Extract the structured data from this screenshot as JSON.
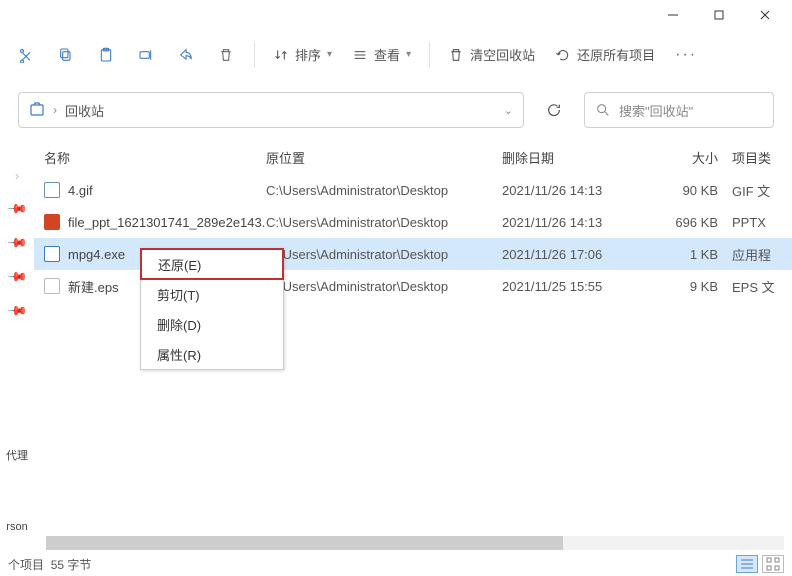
{
  "titlebar": {},
  "toolbar": {
    "sort_label": "排序",
    "view_label": "查看",
    "empty_label": "清空回收站",
    "restore_all_label": "还原所有项目"
  },
  "addressbar": {
    "location": "回收站",
    "search_placeholder": "搜索\"回收站\""
  },
  "columns": {
    "name": "名称",
    "path": "原位置",
    "date": "删除日期",
    "size": "大小",
    "type": "项目类"
  },
  "files": [
    {
      "name": "4.gif",
      "path": "C:\\Users\\Administrator\\Desktop",
      "date": "2021/11/26 14:13",
      "size": "90 KB",
      "type": "GIF 文",
      "kind": "gif"
    },
    {
      "name": "file_ppt_1621301741_289e2e143...",
      "path": "C:\\Users\\Administrator\\Desktop",
      "date": "2021/11/26 14:13",
      "size": "696 KB",
      "type": "PPTX",
      "kind": "ppt"
    },
    {
      "name": "mpg4.exe",
      "path": "C:\\Users\\Administrator\\Desktop",
      "date": "2021/11/26 17:06",
      "size": "1 KB",
      "type": "应用程",
      "kind": "exe",
      "selected": true
    },
    {
      "name": "新建.eps",
      "path": "C:\\Users\\Administrator\\Desktop",
      "date": "2021/11/25 15:55",
      "size": "9 KB",
      "type": "EPS 文",
      "kind": "eps"
    }
  ],
  "context_menu": {
    "restore": "还原(E)",
    "cut": "剪切(T)",
    "delete": "删除(D)",
    "properties": "属性(R)"
  },
  "left_labels": {
    "l1": "代理",
    "l2": "rson"
  },
  "statusbar": {
    "items": "个项目",
    "bytes": "55 字节"
  }
}
